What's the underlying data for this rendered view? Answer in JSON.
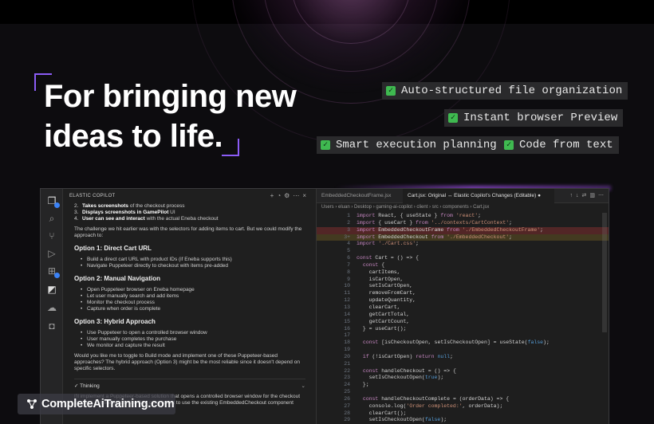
{
  "hero": {
    "line1": "For bringing new",
    "line2": "ideas to life."
  },
  "features": [
    {
      "label": "Auto-structured file organization"
    },
    {
      "label": "Instant browser Preview"
    },
    {
      "label": "Smart execution planning"
    },
    {
      "label": "Code from text"
    }
  ],
  "chat": {
    "title": "ELASTIC COPILOT",
    "list": [
      {
        "num": "2.",
        "bold": "Takes screenshots",
        "rest": " of the checkout process"
      },
      {
        "num": "3.",
        "bold": "Displays screenshots in GamePilot",
        "rest": " UI"
      },
      {
        "num": "4.",
        "bold": "User can see and interact",
        "rest": " with the actual Eneba checkout"
      }
    ],
    "intro": "The challenge we hit earlier was with the selectors for adding items to cart. But we could modify the approach to:",
    "options": [
      {
        "title": "Option 1: Direct Cart URL",
        "bullets": [
          "Build a direct cart URL with product IDs (if Eneba supports this)",
          "Navigate Puppeteer directly to checkout with items pre-added"
        ]
      },
      {
        "title": "Option 2: Manual Navigation",
        "bullets": [
          "Open Puppeteer browser on Eneba homepage",
          "Let user manually search and add items",
          "Monitor the checkout process",
          "Capture when order is complete"
        ]
      },
      {
        "title": "Option 3: Hybrid Approach",
        "bullets": [
          "Use Puppeteer to open a controlled browser window",
          "User manually completes the purchase",
          "We monitor and capture the result"
        ]
      }
    ],
    "closing": "Would you like me to toggle to Build mode and implement one of these Puppeteer-based approaches? The hybrid approach (Option 3) might be the most reliable since it doesn't depend on specific selectors.",
    "thinking": "Thinking",
    "after": "I'll implement a Puppeteer-based solution that opens a controlled browser window for the checkout process. Let me modify the Cart component to use the existing EmbeddedCheckout component"
  },
  "editor": {
    "tab1": "EmbeddedCheckoutFrame.jsx",
    "tab2": "Cart.jsx: Original ↔ Elastic Copilot's Changes (Editable)",
    "breadcrumb": "Users › eluan › Desktop › gaming-ai-copilot › client › src › components › Cart.jsx",
    "lines": [
      {
        "n": "1",
        "code": "import React, { useState } from 'react';"
      },
      {
        "n": "2",
        "code": "import { useCart } from '../contexts/CartContext';"
      },
      {
        "n": "3",
        "code": "import EmbeddedCheckoutFrame from './EmbeddedCheckoutFrame';"
      },
      {
        "n": "3+",
        "code": "import EmbeddedCheckout from './EmbeddedCheckout';"
      },
      {
        "n": "4",
        "code": "import './Cart.css';"
      },
      {
        "n": "5",
        "code": ""
      },
      {
        "n": "6",
        "code": "const Cart = () => {"
      },
      {
        "n": "7",
        "code": "  const {"
      },
      {
        "n": "8",
        "code": "    cartItems,"
      },
      {
        "n": "9",
        "code": "    isCartOpen,"
      },
      {
        "n": "10",
        "code": "    setIsCartOpen,"
      },
      {
        "n": "11",
        "code": "    removeFromCart,"
      },
      {
        "n": "12",
        "code": "    updateQuantity,"
      },
      {
        "n": "13",
        "code": "    clearCart,"
      },
      {
        "n": "14",
        "code": "    getCartTotal,"
      },
      {
        "n": "15",
        "code": "    getCartCount,"
      },
      {
        "n": "16",
        "code": "  } = useCart();"
      },
      {
        "n": "17",
        "code": ""
      },
      {
        "n": "18",
        "code": "  const [isCheckoutOpen, setIsCheckoutOpen] = useState(false);"
      },
      {
        "n": "19",
        "code": ""
      },
      {
        "n": "20",
        "code": "  if (!isCartOpen) return null;"
      },
      {
        "n": "21",
        "code": ""
      },
      {
        "n": "22",
        "code": "  const handleCheckout = () => {"
      },
      {
        "n": "23",
        "code": "    setIsCheckoutOpen(true);"
      },
      {
        "n": "24",
        "code": "  };"
      },
      {
        "n": "25",
        "code": ""
      },
      {
        "n": "26",
        "code": "  const handleCheckoutComplete = (orderData) => {"
      },
      {
        "n": "27",
        "code": "    console.log('Order completed:', orderData);"
      },
      {
        "n": "28",
        "code": "    clearCart();"
      },
      {
        "n": "29",
        "code": "    setIsCheckoutOpen(false);"
      },
      {
        "n": "30",
        "code": "    setIsCartOpen(false);"
      }
    ]
  },
  "brand": {
    "text": "CompleteAiTraining.com"
  },
  "colors": {
    "accent": "#8b5cf6",
    "check": "#3fb950",
    "deleted": "#dc3c3c",
    "added": "#c8a028"
  }
}
